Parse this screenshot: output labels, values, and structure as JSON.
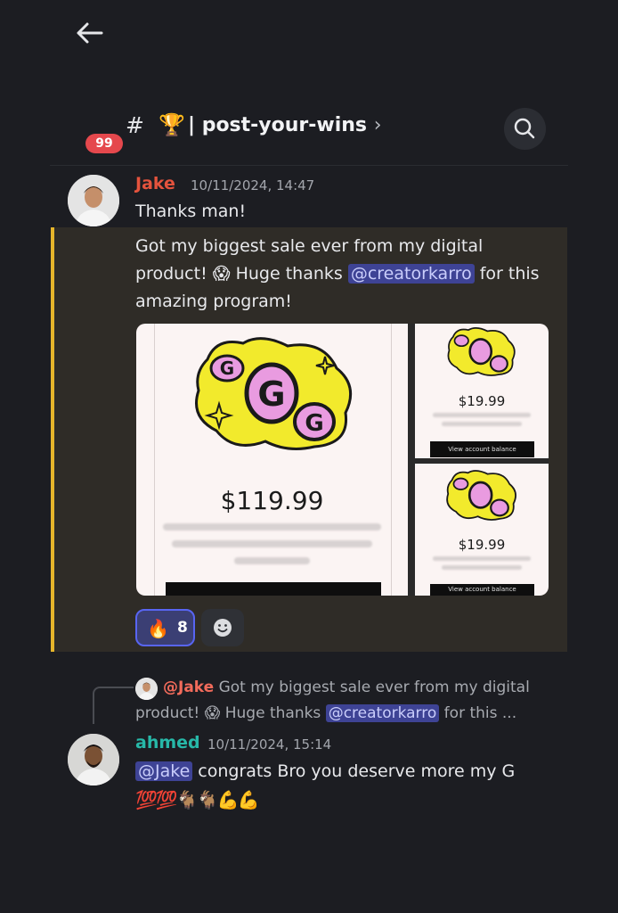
{
  "header": {
    "unread_count": "99",
    "hash": "#",
    "channel_icon": "🏆",
    "channel_name": "| post-your-wins",
    "chevron": "›"
  },
  "message1": {
    "author": "Jake",
    "author_color": "#e5533d",
    "timestamp": "10/11/2024, 14:47",
    "line1": "Thanks man!",
    "body_part1": "Got my biggest sale ever from my digital product! ",
    "emoji": "😱",
    "body_part2": " Huge thanks ",
    "mention": "@creatorkarro",
    "body_part3": " for this amazing program!"
  },
  "attachments": {
    "main_price": "$119.99",
    "side_price_top": "$19.99",
    "side_price_bottom": "$19.99",
    "button_label": "View account balance",
    "logo_letters": [
      "G",
      "G",
      "G"
    ]
  },
  "reactions": {
    "emoji": "🔥",
    "count": "8"
  },
  "reply_preview": {
    "author": "@Jake",
    "text_part1": " Got my biggest sale ever from my digital product! ",
    "emoji": "😱",
    "text_part2": " Huge thanks ",
    "mention": "@creatorkarro",
    "text_part3": " for this ..."
  },
  "message2": {
    "author": "ahmed",
    "author_color": "#27b8a8",
    "timestamp": "10/11/2024, 15:14",
    "mention": "@Jake",
    "text": " congrats Bro you deserve more my G",
    "emojis": "💯💯🐐🐐💪💪"
  },
  "colors": {
    "background": "#1c1d22",
    "highlight": "#2f2c27",
    "highlight_bar": "#e6b52b",
    "mention_bg": "#3e4395",
    "badge": "#e5484d"
  }
}
